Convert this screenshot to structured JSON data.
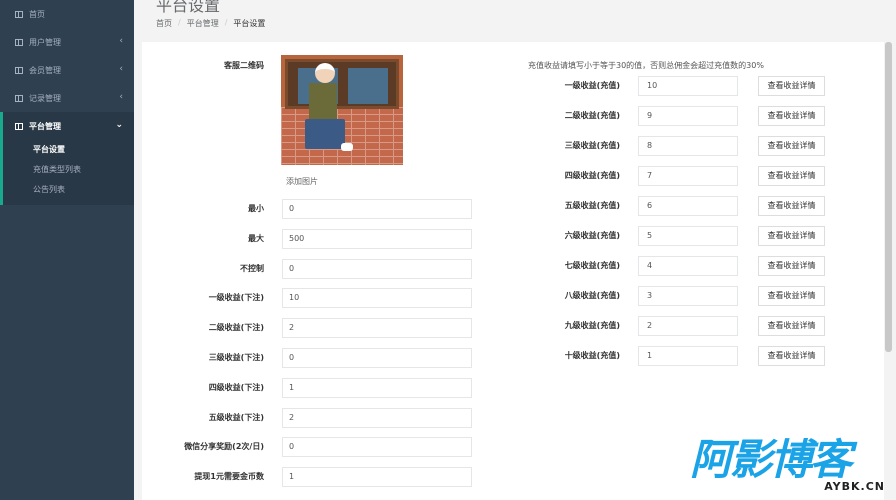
{
  "sidebar": {
    "items": [
      {
        "label": "首页",
        "icon": "grid-icon",
        "expandable": false
      },
      {
        "label": "用户管理",
        "icon": "grid-icon",
        "expandable": true
      },
      {
        "label": "会员管理",
        "icon": "grid-icon",
        "expandable": true
      },
      {
        "label": "记录管理",
        "icon": "grid-icon",
        "expandable": true
      }
    ],
    "active": {
      "label": "平台管理",
      "icon": "grid-icon",
      "sub_items": [
        {
          "label": "平台设置",
          "current": true
        },
        {
          "label": "充值类型列表",
          "current": false
        },
        {
          "label": "公告列表",
          "current": false
        }
      ]
    },
    "chevron_left": "‹",
    "chevron_down": "⌄"
  },
  "header": {
    "title": "平台设置",
    "breadcrumb": [
      "首页",
      "平台管理",
      "平台设置"
    ]
  },
  "left_form": {
    "qr_label": "客服二维码",
    "add_image_label": "添加图片",
    "fields": [
      {
        "label": "最小",
        "value": "0"
      },
      {
        "label": "最大",
        "value": "500"
      },
      {
        "label": "不控制",
        "value": "0"
      },
      {
        "label": "一级收益(下注)",
        "value": "10"
      },
      {
        "label": "二级收益(下注)",
        "value": "2"
      },
      {
        "label": "三级收益(下注)",
        "value": "0"
      },
      {
        "label": "四级收益(下注)",
        "value": "1"
      },
      {
        "label": "五级收益(下注)",
        "value": "2"
      },
      {
        "label": "微信分享奖励(2次/日)",
        "value": "0"
      },
      {
        "label": "提现1元需要金币数",
        "value": "1"
      }
    ]
  },
  "right_form": {
    "note": "充值收益请填写小于等于30的值，否则总佣金会超过充值数的30%",
    "button_label": "查看收益详情",
    "fields": [
      {
        "label": "一级收益(充值)",
        "value": "10"
      },
      {
        "label": "二级收益(充值)",
        "value": "9"
      },
      {
        "label": "三级收益(充值)",
        "value": "8"
      },
      {
        "label": "四级收益(充值)",
        "value": "7"
      },
      {
        "label": "五级收益(充值)",
        "value": "6"
      },
      {
        "label": "六级收益(充值)",
        "value": "5"
      },
      {
        "label": "七级收益(充值)",
        "value": "4"
      },
      {
        "label": "八级收益(充值)",
        "value": "3"
      },
      {
        "label": "九级收益(充值)",
        "value": "2"
      },
      {
        "label": "十级收益(充值)",
        "value": "1"
      }
    ]
  },
  "watermark": {
    "cn": "阿影博客",
    "en": "AYBK.CN"
  },
  "colors": {
    "sidebar_bg": "#2f4050",
    "sidebar_active_bg": "#293846",
    "accent": "#19aa8d",
    "watermark_blue": "#1aa3e6"
  }
}
